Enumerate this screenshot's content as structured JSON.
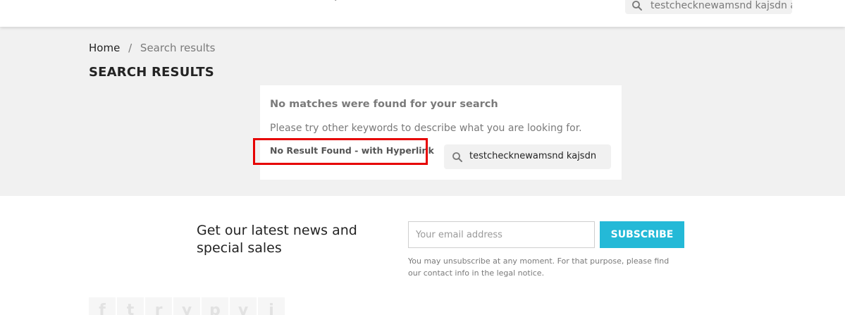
{
  "header": {
    "search_value": "testchecknewamsnd kajsdn ak"
  },
  "breadcrumb": {
    "home": "Home",
    "separator": "/",
    "current": "Search results"
  },
  "page_title": "SEARCH RESULTS",
  "no_results": {
    "heading": "No matches were found for your search",
    "hint": "Please try other keywords to describe what you are looking for.",
    "link": "No Result Found - with Hyperlink",
    "search_value": "testchecknewamsnd kajsdn ak"
  },
  "newsletter": {
    "title": "Get our latest news and special sales",
    "email_placeholder": "Your email address",
    "subscribe_label": "SUBSCRIBE",
    "note": "You may unsubscribe at any moment. For that purpose, please find our contact info in the legal notice."
  },
  "social": [
    {
      "icon": "facebook-icon",
      "glyph": "f"
    },
    {
      "icon": "twitter-icon",
      "glyph": "t"
    },
    {
      "icon": "rss-icon",
      "glyph": "r"
    },
    {
      "icon": "youtube-icon",
      "glyph": "y"
    },
    {
      "icon": "pinterest-icon",
      "glyph": "p"
    },
    {
      "icon": "vimeo-icon",
      "glyph": "v"
    },
    {
      "icon": "instagram-icon",
      "glyph": "i"
    }
  ],
  "colors": {
    "accent": "#24b9d7",
    "highlight": "#e60000",
    "background": "#f1f1f1"
  }
}
